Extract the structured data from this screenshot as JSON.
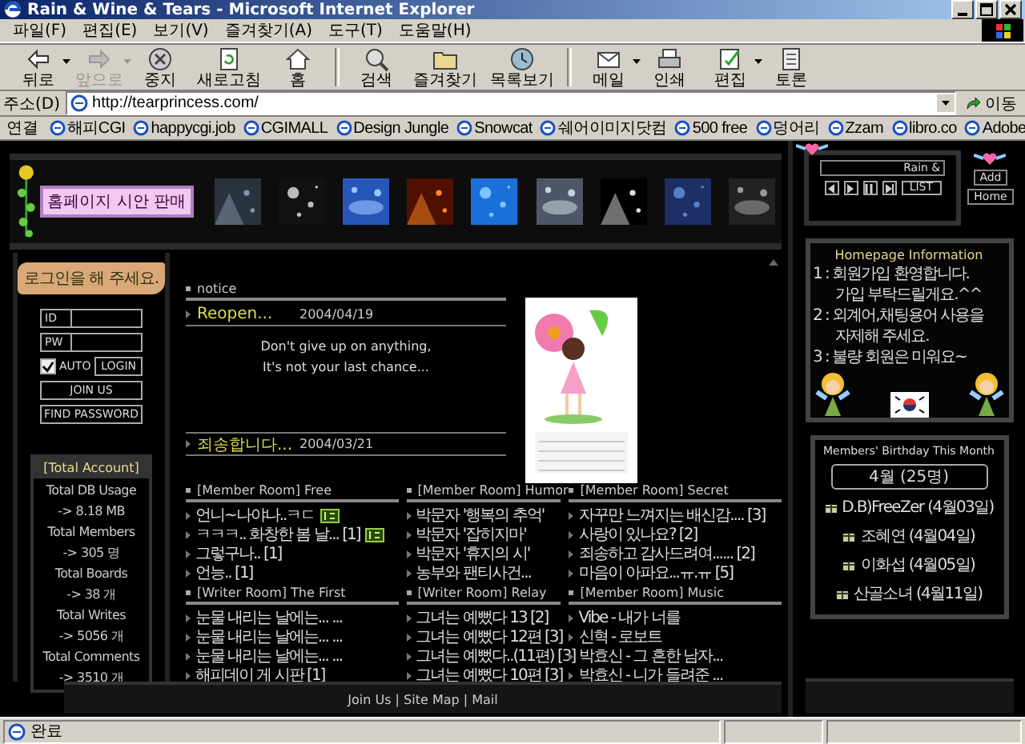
{
  "window": {
    "title": "Rain & Wine & Tears - Microsoft Internet Explorer"
  },
  "menu": [
    "파일(F)",
    "편집(E)",
    "보기(V)",
    "즐겨찾기(A)",
    "도구(T)",
    "도움말(H)"
  ],
  "toolbar": [
    {
      "label": "뒤로",
      "kind": "back",
      "disabled": false,
      "dropdown": true
    },
    {
      "label": "앞으로",
      "kind": "forward",
      "disabled": true,
      "dropdown": true
    },
    {
      "label": "중지",
      "kind": "stop",
      "disabled": false,
      "dropdown": false
    },
    {
      "label": "새로고침",
      "kind": "refresh",
      "disabled": false,
      "dropdown": false
    },
    {
      "label": "홈",
      "kind": "home",
      "disabled": false,
      "dropdown": false
    },
    {
      "label": "검색",
      "kind": "search",
      "disabled": false,
      "dropdown": false
    },
    {
      "label": "즐겨찾기",
      "kind": "favorites",
      "disabled": false,
      "dropdown": false
    },
    {
      "label": "목록보기",
      "kind": "history",
      "disabled": false,
      "dropdown": false
    },
    {
      "label": "메일",
      "kind": "mail",
      "disabled": false,
      "dropdown": true
    },
    {
      "label": "인쇄",
      "kind": "print",
      "disabled": false,
      "dropdown": false
    },
    {
      "label": "편집",
      "kind": "edit",
      "disabled": false,
      "dropdown": true
    },
    {
      "label": "토론",
      "kind": "discuss",
      "disabled": false,
      "dropdown": false
    }
  ],
  "address": {
    "label": "주소(D)",
    "url": "http://tearprincess.com/",
    "go": "이동"
  },
  "links": {
    "label": "연결",
    "items": [
      "해피CGI",
      "happycgi.job",
      "CGIMALL",
      "Design Jungle",
      "Snowcat",
      "쉐어이미지닷컴",
      "500 free",
      "덩어리",
      "Zzam",
      "libro.co",
      "Adobe"
    ]
  },
  "banner": {
    "label": "홈페이지 시안 판매"
  },
  "login": {
    "sign": "로그인을 해 주세요.",
    "id_label": "ID",
    "pw_label": "PW",
    "auto": {
      "label": "AUTO",
      "checked": true
    },
    "login": "LOGIN",
    "join": "JOIN US",
    "find": "FIND PASSWORD"
  },
  "stats": {
    "title": "[Total Account]",
    "rows": [
      "Total DB Usage",
      "-> 8.18 MB",
      "Total Members",
      "-> 305 명",
      "Total Boards",
      "-> 38 개",
      "Total Writes",
      "-> 5056 개",
      "Total Comments",
      "-> 3510 개"
    ]
  },
  "notice": {
    "title": "notice",
    "items": [
      {
        "title": "Reopen...",
        "date": "2004/04/19"
      },
      {
        "title": "죄송합니다...",
        "date": "2004/03/21"
      }
    ],
    "message": [
      "Don't give up on anything,",
      "It's not your last chance..."
    ]
  },
  "boards": [
    {
      "title": "[Member Room] Free",
      "posts": [
        {
          "title": "언니~나야나..ㅋㄷ",
          "new": true
        },
        {
          "title": "ㅋㅋㅋ.. 화창한 봄 날... [1]",
          "new": true
        },
        {
          "title": "그렇구나.. [1]",
          "new": false
        },
        {
          "title": "언능.. [1]",
          "new": false
        }
      ]
    },
    {
      "title": "[Member Room] Humor",
      "posts": [
        {
          "title": "박문자 '행복의 추억'",
          "new": false
        },
        {
          "title": "박문자 '잡히지마'",
          "new": false
        },
        {
          "title": "박문자 '휴지의 시'",
          "new": false
        },
        {
          "title": "농부와 팬티사건...",
          "new": false
        }
      ]
    },
    {
      "title": "[Member Room] Secret",
      "posts": [
        {
          "title": "자꾸만 느껴지는 배신감.... [3]",
          "new": false
        },
        {
          "title": "사랑이 있나요? [2]",
          "new": false
        },
        {
          "title": "죄송하고 감사드려여...... [2]",
          "new": false
        },
        {
          "title": "마음이 아파요...ㅠ.ㅠ [5]",
          "new": false
        }
      ]
    },
    {
      "title": "[Writer Room] The First",
      "posts": [
        {
          "title": "눈물 내리는 날에는... ...",
          "new": false
        },
        {
          "title": "눈물 내리는 날에는... ...",
          "new": false
        },
        {
          "title": "눈물 내리는 날에는... ...",
          "new": false
        },
        {
          "title": "해피데이 게 시판 [1]",
          "new": false
        }
      ]
    },
    {
      "title": "[Writer Room] Relay",
      "posts": [
        {
          "title": "그녀는 예뻤다 13 [2]",
          "new": false
        },
        {
          "title": "그녀는 예뻤다 12편 [3]",
          "new": false
        },
        {
          "title": "그녀는 예뻤다..(11편) [3]",
          "new": false
        },
        {
          "title": "그녀는 예뻤다 10편 [3]",
          "new": false
        }
      ]
    },
    {
      "title": "[Member Room] Music",
      "posts": [
        {
          "title": "Vibe - 내가 너를",
          "new": false
        },
        {
          "title": "신혁 - 로보트",
          "new": false
        },
        {
          "title": "박효신 - 그 흔한 남자...",
          "new": false
        },
        {
          "title": "박효신 - 니가 들려준 ...",
          "new": false
        }
      ]
    }
  ],
  "footer": {
    "text": "Join Us | Site Map | Mail"
  },
  "player": {
    "track": "Rain &",
    "controls": [
      {
        "kind": "prev"
      },
      {
        "kind": "play"
      },
      {
        "kind": "pause"
      },
      {
        "kind": "next"
      }
    ],
    "list": "LIST",
    "add": "Add",
    "home": "Home"
  },
  "info": {
    "title": "Homepage Information",
    "lines": [
      "1 : 회원가입 환영합니다.",
      "가입 부탁드릴게요.^^",
      "2 : 외계어,채팅용어 사용을",
      "자제해 주세요.",
      "3 : 불량 회원은 미워요~"
    ]
  },
  "birthday": {
    "title": "Members' Birthday This Month",
    "month": "4월 (25명)",
    "members": [
      "D.B)FreeZer (4월03일)",
      "조혜연 (4월04일)",
      "이화섭 (4월05일)",
      "산골소녀 (4월11일)"
    ]
  },
  "status": {
    "text": "완료"
  }
}
